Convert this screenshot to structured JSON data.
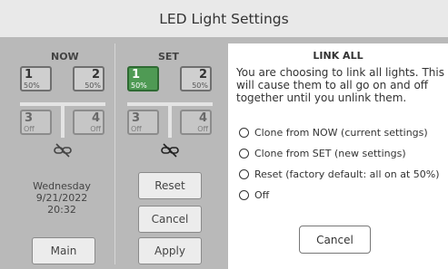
{
  "title": "LED Light Settings",
  "now": {
    "label": "NOW",
    "lights": [
      {
        "num": "1",
        "level": "50%"
      },
      {
        "num": "2",
        "level": "50%"
      },
      {
        "num": "3",
        "level": "Off"
      },
      {
        "num": "4",
        "level": "Off"
      }
    ],
    "date": {
      "day": "Wednesday",
      "date": "9/21/2022",
      "time": "20:32"
    },
    "main_label": "Main"
  },
  "set": {
    "label": "SET",
    "lights": [
      {
        "num": "1",
        "level": "50%",
        "selected": true
      },
      {
        "num": "2",
        "level": "50%"
      },
      {
        "num": "3",
        "level": "Off"
      },
      {
        "num": "4",
        "level": "Off"
      }
    ],
    "reset_label": "Reset",
    "cancel_label": "Cancel",
    "apply_label": "Apply"
  },
  "link_panel": {
    "title": "LINK ALL",
    "message": "You are choosing to link all lights. This will cause them to all go on and off together until you unlink them.",
    "options": [
      "Clone from NOW (current settings)",
      "Clone from SET (new settings)",
      "Reset (factory default: all on at 50%)",
      "Off"
    ],
    "cancel_label": "Cancel"
  },
  "colors": {
    "active_tile": "#4f9a54",
    "background": "#b9b9b9",
    "panel": "#ffffff"
  }
}
